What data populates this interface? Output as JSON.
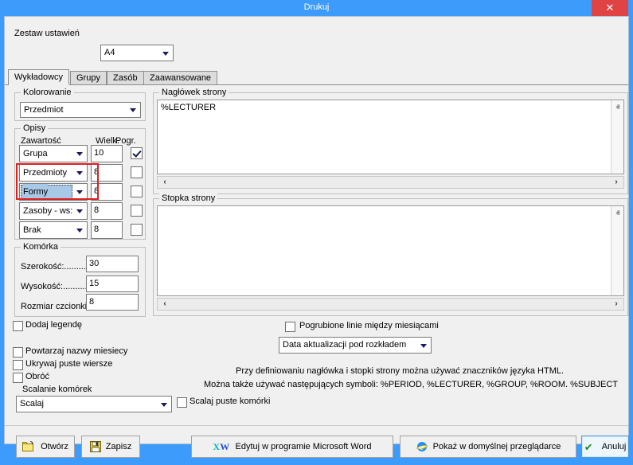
{
  "window": {
    "title": "Drukuj",
    "close_label": "✕",
    "titlebar_color": "#3d9bfc",
    "close_color": "#e04343"
  },
  "top": {
    "settings_label": "Zestaw ustawień",
    "settings_value": "A4"
  },
  "tabs": [
    {
      "label": "Wykładowcy",
      "active": true
    },
    {
      "label": "Grupy",
      "active": false
    },
    {
      "label": "Zasób",
      "active": false
    },
    {
      "label": "Zaawansowane",
      "active": false
    }
  ],
  "kolorowanie": {
    "group_label": "Kolorowanie",
    "value": "Przedmiot"
  },
  "opisy": {
    "group_label": "Opisy",
    "col_content": "Zawartość",
    "col_size": "Wielk.",
    "col_bold": "Pogr.",
    "rows": [
      {
        "content": "Grupa",
        "size": "10",
        "bold": true,
        "selected": false
      },
      {
        "content": "Przedmioty",
        "size": "8",
        "bold": false,
        "selected": false
      },
      {
        "content": "Formy",
        "size": "8",
        "bold": false,
        "selected": true
      },
      {
        "content": "Zasoby - ws:",
        "size": "8",
        "bold": false,
        "selected": false
      },
      {
        "content": "Brak",
        "size": "8",
        "bold": false,
        "selected": false
      }
    ],
    "highlight_color": "#e02020"
  },
  "komorka": {
    "group_label": "Komórka",
    "fields": [
      {
        "label": "Szerokość:...........",
        "value": "30"
      },
      {
        "label": "Wysokość:...........",
        "value": "15"
      },
      {
        "label": "Rozmiar czcionki: .",
        "value": "8"
      }
    ]
  },
  "left_options": {
    "legenda": {
      "label": "Dodaj legendę",
      "checked": false
    },
    "powtarzaj": {
      "label": "Powtarzaj nazwy miesiecy",
      "checked": false
    },
    "ukrywaj": {
      "label": "Ukrywaj puste wiersze",
      "checked": false
    },
    "obroc": {
      "label": "Obróć",
      "checked": false
    },
    "scalanie_label": "Scalanie komórek",
    "scalanie_value": "Scalaj",
    "scalaj_puste": {
      "label": "Scalaj puste komórki",
      "checked": false
    }
  },
  "naglowek": {
    "group_label": "Nagłówek strony",
    "text": "%LECTURER",
    "scroll_up": "ⱏ",
    "scroll_down": "ⱟ",
    "scroll_left": "‹",
    "scroll_right": "›"
  },
  "stopka": {
    "group_label": "Stopka strony",
    "text": "",
    "scroll_up": "ⱏ",
    "scroll_down": "ⱟ",
    "scroll_left": "‹",
    "scroll_right": "›"
  },
  "right_options": {
    "pogrubione": {
      "label": "Pogrubione linie między miesiącami",
      "checked": false
    },
    "data_value": "Data aktualizacji pod rozkładem"
  },
  "hints": {
    "line1": "Przy definiowaniu nagłówka i stopki strony można używać znaczników języka HTML.",
    "line2": "Można także używać następujących symboli: %PERIOD, %LECTURER, %GROUP, %ROOM. %SUBJECT"
  },
  "buttons": {
    "otworz": "Otwórz",
    "zapisz": "Zapisz",
    "word": "Edytuj w programie Microsoft Word",
    "browser": "Pokaż w domyślnej przeglądarce",
    "anuluj": "Anuluj",
    "xw_x": "X",
    "xw_w": "W",
    "check_glyph": "✔"
  }
}
